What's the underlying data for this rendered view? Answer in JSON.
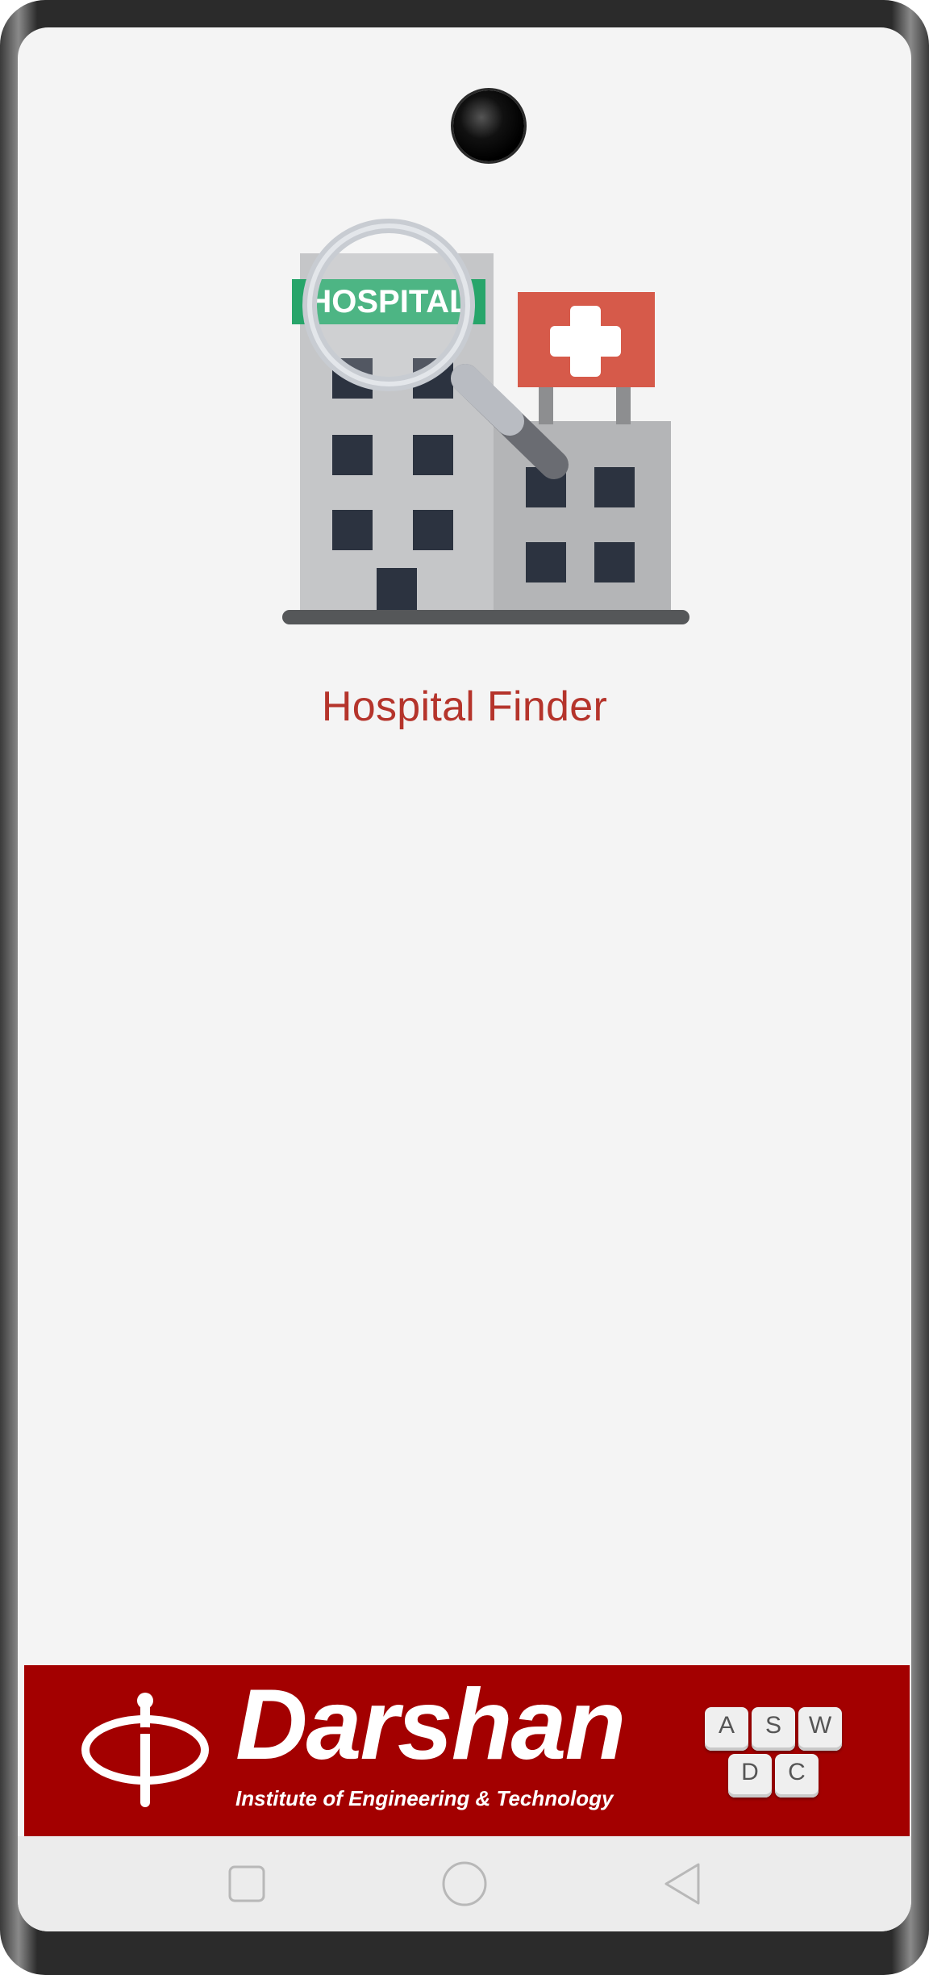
{
  "app": {
    "title": "Hospital Finder",
    "illustration_sign": "HOSPITAL"
  },
  "banner": {
    "name": "Darshan",
    "tagline": "Institute of Engineering & Technology",
    "keys": [
      "A",
      "S",
      "W",
      "D",
      "C"
    ]
  },
  "nav": {
    "recents": "recents-icon",
    "home": "home-icon",
    "back": "back-icon"
  },
  "colors": {
    "title": "#b5342b",
    "banner_bg": "#a30000",
    "screen_bg": "#f4f4f4",
    "sign_green": "#27a56a",
    "cross_red": "#d65a4a"
  }
}
